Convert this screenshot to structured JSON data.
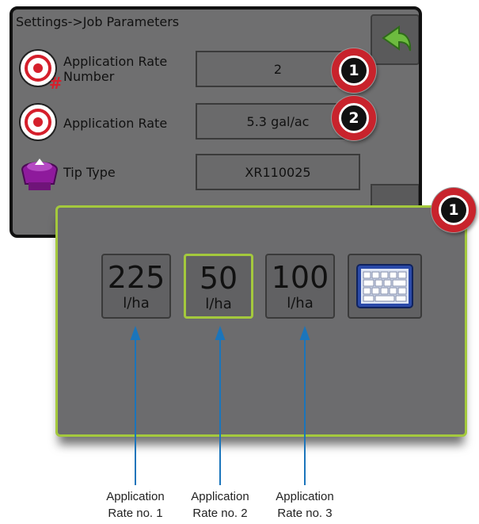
{
  "screen": {
    "title": "Settings->Job Parameters",
    "rows": [
      {
        "label": "Application Rate Number",
        "value": "2",
        "icon": "target-hash-icon"
      },
      {
        "label": "Application Rate",
        "value": "5.3 gal/ac",
        "icon": "target-icon"
      },
      {
        "label": "Tip Type",
        "value": "XR110025",
        "icon": "nozzle-tip-icon"
      }
    ],
    "back_icon": "back-arrow-icon"
  },
  "badges": {
    "one": "1",
    "two": "2",
    "popup_one": "1"
  },
  "popup": {
    "rates": [
      {
        "value": "225",
        "unit": "l/ha",
        "selected": false
      },
      {
        "value": "50",
        "unit": "l/ha",
        "selected": true
      },
      {
        "value": "100",
        "unit": "l/ha",
        "selected": false
      }
    ],
    "keyboard_icon": "keyboard-icon"
  },
  "captions": {
    "rate1_line1": "Application",
    "rate1_line2": "Rate no. 1",
    "rate2_line1": "Application",
    "rate2_line2": "Rate no. 2",
    "rate3_line1": "Application",
    "rate3_line2": "Rate no. 3"
  },
  "colors": {
    "accent": "#a4c93d",
    "badge": "#c8232c",
    "arrow": "#1b75bb",
    "back_arrow": "#6dbb3f"
  }
}
